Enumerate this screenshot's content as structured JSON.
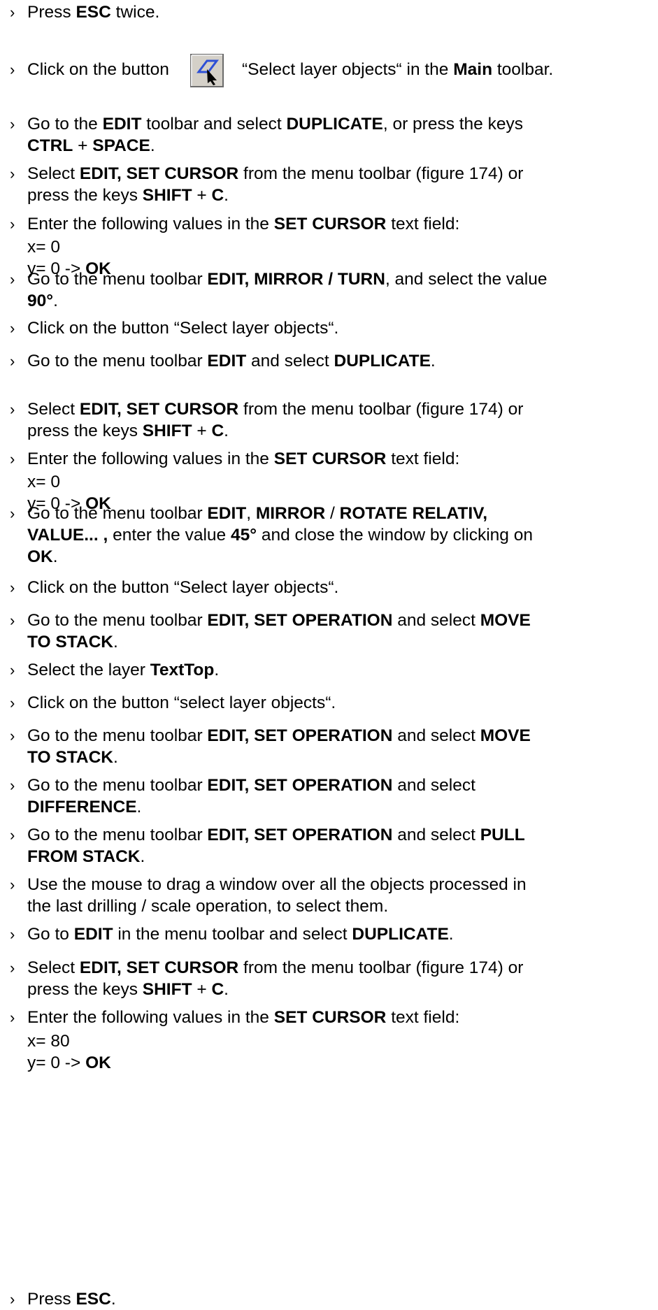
{
  "steps": [
    {
      "bullet": "›",
      "parts": [
        {
          "t": "Press "
        },
        {
          "t": "ESC",
          "b": true
        },
        {
          "t": " twice."
        }
      ]
    },
    {
      "bullet": "›",
      "parts": [
        {
          "t": "Click on the button"
        },
        {
          "icon": "select-layer-objects-icon"
        },
        {
          "t": "“Select layer objects“ in the "
        },
        {
          "t": "Main",
          "b": true
        },
        {
          "t": " toolbar."
        }
      ]
    },
    {
      "bullet": "›",
      "parts": [
        {
          "t": "Go to the "
        },
        {
          "t": "EDIT",
          "b": true
        },
        {
          "t": " toolbar and select "
        },
        {
          "t": "DUPLICATE",
          "b": true
        },
        {
          "t": ", or press the keys "
        },
        {
          "br": true
        },
        {
          "t": "CTRL",
          "b": true
        },
        {
          "t": " + "
        },
        {
          "t": "SPACE",
          "b": true
        },
        {
          "t": "."
        }
      ]
    },
    {
      "bullet": "›",
      "parts": [
        {
          "t": "Select "
        },
        {
          "t": "EDIT, SET CURSOR",
          "b": true
        },
        {
          "t": " from the menu toolbar (figure 174) or "
        },
        {
          "br": true
        },
        {
          "t": "press the keys "
        },
        {
          "t": "SHIFT",
          "b": true
        },
        {
          "t": " + "
        },
        {
          "t": "C",
          "b": true
        },
        {
          "t": "."
        }
      ]
    },
    {
      "bullet": "›",
      "parts": [
        {
          "t": "Enter the following values in the "
        },
        {
          "t": "SET CURSOR",
          "b": true
        },
        {
          "t": " text field:"
        }
      ]
    },
    {
      "bullet": "›",
      "parts": [
        {
          "t": "Go to the menu toolbar "
        },
        {
          "t": "EDIT, MIRROR / TURN",
          "b": true
        },
        {
          "t": ", and select the value "
        },
        {
          "br": true
        },
        {
          "t": "90°",
          "b": true
        },
        {
          "t": "."
        }
      ]
    },
    {
      "bullet": "›",
      "parts": [
        {
          "t": "Click on the button “Select layer objects“."
        }
      ]
    },
    {
      "bullet": "›",
      "parts": [
        {
          "t": "Go to the menu toolbar "
        },
        {
          "t": "EDIT",
          "b": true
        },
        {
          "t": " and select "
        },
        {
          "t": "DUPLICATE",
          "b": true
        },
        {
          "t": "."
        }
      ]
    },
    {
      "bullet": "›",
      "parts": [
        {
          "t": "Select "
        },
        {
          "t": "EDIT, SET CURSOR",
          "b": true
        },
        {
          "t": " from the menu toolbar (figure 174) or "
        },
        {
          "br": true
        },
        {
          "t": "press the keys "
        },
        {
          "t": "SHIFT",
          "b": true
        },
        {
          "t": " + "
        },
        {
          "t": "C",
          "b": true
        },
        {
          "t": "."
        }
      ]
    },
    {
      "bullet": "›",
      "parts": [
        {
          "t": "Enter the following values in the "
        },
        {
          "t": "SET CURSOR",
          "b": true
        },
        {
          "t": " text field:"
        }
      ]
    },
    {
      "bullet": "›",
      "parts": [
        {
          "t": "Go to the menu toolbar "
        },
        {
          "t": "EDIT",
          "b": true
        },
        {
          "t": ", "
        },
        {
          "t": "MIRROR",
          "b": true
        },
        {
          "t": " / "
        },
        {
          "t": "ROTATE RELATIV,",
          "b": true
        },
        {
          "br": true
        },
        {
          "t": "VALUE... ,",
          "b": true
        },
        {
          "t": " enter the value "
        },
        {
          "t": "45°",
          "b": true
        },
        {
          "t": " and close the window by clicking on "
        },
        {
          "br": true
        },
        {
          "t": "OK",
          "b": true
        },
        {
          "t": "."
        }
      ]
    },
    {
      "bullet": "›",
      "parts": [
        {
          "t": "Click on the button “Select layer objects“."
        }
      ]
    },
    {
      "bullet": "›",
      "parts": [
        {
          "t": "Go to the menu toolbar "
        },
        {
          "t": "EDIT, SET OPERATION",
          "b": true
        },
        {
          "t": " and select "
        },
        {
          "t": "MOVE",
          "b": true
        },
        {
          "br": true
        },
        {
          "t": "TO STACK",
          "b": true
        },
        {
          "t": "."
        }
      ]
    },
    {
      "bullet": "›",
      "parts": [
        {
          "t": "Select the layer "
        },
        {
          "t": "TextTop",
          "b": true
        },
        {
          "t": "."
        }
      ]
    },
    {
      "bullet": "›",
      "parts": [
        {
          "t": "Click on the button “select layer objects“."
        }
      ]
    },
    {
      "bullet": "›",
      "parts": [
        {
          "t": "Go to the menu toolbar "
        },
        {
          "t": "EDIT, SET OPERATION",
          "b": true
        },
        {
          "t": " and select "
        },
        {
          "t": "MOVE",
          "b": true
        },
        {
          "br": true
        },
        {
          "t": "TO STACK",
          "b": true
        },
        {
          "t": "."
        }
      ]
    },
    {
      "bullet": "›",
      "parts": [
        {
          "t": "Go to the menu toolbar "
        },
        {
          "t": "EDIT, SET OPERATION",
          "b": true
        },
        {
          "t": " and select "
        },
        {
          "br": true
        },
        {
          "t": "DIFFERENCE",
          "b": true
        },
        {
          "t": "."
        }
      ]
    },
    {
      "bullet": "›",
      "parts": [
        {
          "t": "Go to the menu toolbar "
        },
        {
          "t": "EDIT, SET OPERATION",
          "b": true
        },
        {
          "t": " and select "
        },
        {
          "t": "PULL",
          "b": true
        },
        {
          "br": true
        },
        {
          "t": "FROM STACK",
          "b": true
        },
        {
          "t": "."
        }
      ]
    },
    {
      "bullet": "›",
      "parts": [
        {
          "t": "Use the mouse to drag a window over all the objects processed in "
        },
        {
          "br": true
        },
        {
          "t": "the last drilling / scale operation, to select them."
        }
      ]
    },
    {
      "bullet": "›",
      "parts": [
        {
          "t": "Go to "
        },
        {
          "t": "EDIT",
          "b": true
        },
        {
          "t": " in the menu toolbar and select "
        },
        {
          "t": "DUPLICATE",
          "b": true
        },
        {
          "t": "."
        }
      ]
    },
    {
      "bullet": "›",
      "parts": [
        {
          "t": "Select "
        },
        {
          "t": "EDIT, SET CURSOR",
          "b": true
        },
        {
          "t": " from the menu toolbar (figure 174) or "
        },
        {
          "br": true
        },
        {
          "t": "press the keys "
        },
        {
          "t": "SHIFT",
          "b": true
        },
        {
          "t": " + "
        },
        {
          "t": "C",
          "b": true
        },
        {
          "t": "."
        }
      ]
    },
    {
      "bullet": "›",
      "parts": [
        {
          "t": "Enter the following values in the "
        },
        {
          "t": "SET CURSOR",
          "b": true
        },
        {
          "t": " text field:"
        }
      ]
    },
    {
      "bullet": "›",
      "parts": [
        {
          "t": "Press "
        },
        {
          "t": "ESC",
          "b": true
        },
        {
          "t": "."
        }
      ]
    }
  ],
  "values_blocks": [
    {
      "lines": [
        [
          {
            "t": "x= 0"
          }
        ],
        [
          {
            "t": "y= 0 -> "
          },
          {
            "t": "OK",
            "b": true
          }
        ]
      ]
    },
    {
      "lines": [
        [
          {
            "t": "x= 0"
          }
        ],
        [
          {
            "t": "y= 0  -> "
          },
          {
            "t": "OK",
            "b": true
          }
        ]
      ]
    },
    {
      "lines": [
        [
          {
            "t": "x= 80"
          }
        ],
        [
          {
            "t": "y=   0 -> "
          },
          {
            "t": "OK",
            "b": true
          }
        ]
      ]
    }
  ],
  "icon_colors": {
    "frame": "#6b6b6b",
    "frame_light": "#e8e8e8",
    "shape": "#2d4fd6",
    "cursor": "#000000"
  }
}
